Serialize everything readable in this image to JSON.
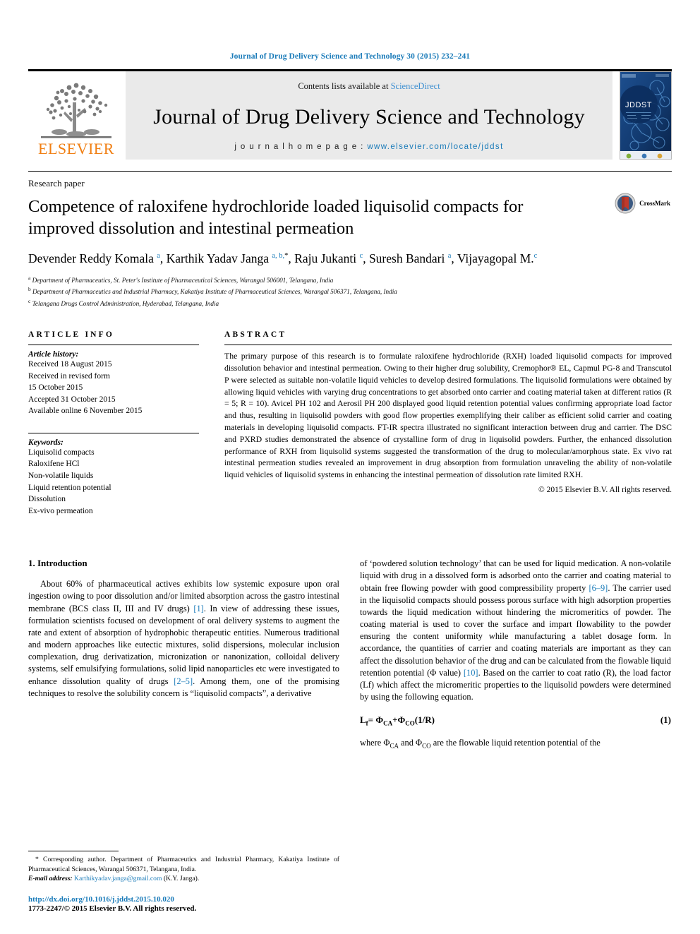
{
  "running_head": "Journal of Drug Delivery Science and Technology 30 (2015) 232–241",
  "masthead": {
    "publisher_name": "ELSEVIER",
    "contents_prefix": "Contents lists available at ",
    "contents_link": "ScienceDirect",
    "journal_name": "Journal of Drug Delivery Science and Technology",
    "homepage_prefix": "j o u r n a l   h o m e p a g e :   ",
    "homepage_url": "www.elsevier.com/locate/jddst",
    "cover_title": "JDDST"
  },
  "article": {
    "type": "Research paper",
    "title": "Competence of raloxifene hydrochloride loaded liquisolid compacts for improved dissolution and intestinal permeation",
    "crossmark_label": "CrossMark",
    "authors_html": "Devender Reddy Komala <sup>a</sup>, Karthik Yadav Janga <sup>a, b,</sup><sup class=\"star\">*</sup>, Raju Jukanti <sup>c</sup>, Suresh Bandari <sup>a</sup>, Vijayagopal M.<sup>c</sup>",
    "affiliations": [
      {
        "mark": "a",
        "text": "Department of Pharmaceutics, St. Peter's Institute of Pharmaceutical Sciences, Warangal 506001, Telangana, India"
      },
      {
        "mark": "b",
        "text": "Department of Pharmaceutics and Industrial Pharmacy, Kakatiya Institute of Pharmaceutical Sciences, Warangal 506371, Telangana, India"
      },
      {
        "mark": "c",
        "text": "Telangana Drugs Control Administration, Hyderabad, Telangana, India"
      }
    ]
  },
  "article_info": {
    "heading": "ARTICLE INFO",
    "history_label": "Article history:",
    "history": [
      "Received 18 August 2015",
      "Received in revised form",
      "15 October 2015",
      "Accepted 31 October 2015",
      "Available online 6 November 2015"
    ],
    "keywords_label": "Keywords:",
    "keywords": [
      "Liquisolid compacts",
      "Raloxifene HCl",
      "Non-volatile liquids",
      "Liquid retention potential",
      "Dissolution",
      "Ex-vivo permeation"
    ]
  },
  "abstract": {
    "heading": "ABSTRACT",
    "text": "The primary purpose of this research is to formulate raloxifene hydrochloride (RXH) loaded liquisolid compacts for improved dissolution behavior and intestinal permeation. Owing to their higher drug solubility, Cremophor® EL, Capmul PG-8 and Transcutol P were selected as suitable non-volatile liquid vehicles to develop desired formulations. The liquisolid formulations were obtained by allowing liquid vehicles with varying drug concentrations to get absorbed onto carrier and coating material taken at different ratios (R = 5; R = 10). Avicel PH 102 and Aerosil PH 200 displayed good liquid retention potential values confirming appropriate load factor and thus, resulting in liquisolid powders with good flow properties exemplifying their caliber as efficient solid carrier and coating materials in developing liquisolid compacts. FT-IR spectra illustrated no significant interaction between drug and carrier. The DSC and PXRD studies demonstrated the absence of crystalline form of drug in liquisolid powders. Further, the enhanced dissolution performance of RXH from liquisolid systems suggested the transformation of the drug to molecular/amorphous state. Ex vivo rat intestinal permeation studies revealed an improvement in drug absorption from formulation unraveling the ability of non-volatile liquid vehicles of liquisolid systems in enhancing the intestinal permeation of dissolution rate limited RXH.",
    "copyright": "© 2015 Elsevier B.V. All rights reserved."
  },
  "introduction": {
    "heading": "1. Introduction",
    "left_paragraph_html": "About 60% of pharmaceutical actives exhibits low systemic exposure upon oral ingestion owing to poor dissolution and/or limited absorption across the gastro intestinal membrane (BCS class II, III and IV drugs) <span class=\"cit\">[1]</span>. In view of addressing these issues, formulation scientists focused on development of oral delivery systems to augment the rate and extent of absorption of hydrophobic therapeutic entities. Numerous traditional and modern approaches like eutectic mixtures, solid dispersions, molecular inclusion complexation, drug derivatization, micronization or nanonization, colloidal delivery systems, self emulsifying formulations, solid lipid nanoparticles etc were investigated to enhance dissolution quality of drugs <span class=\"cit\">[2–5]</span>. Among them, one of the promising techniques to resolve the solubility concern is “liquisolid compacts”, a derivative",
    "right_paragraph_html": "of ‘powdered solution technology’ that can be used for liquid medication. A non-volatile liquid with drug in a dissolved form is adsorbed onto the carrier and coating material to obtain free flowing powder with good compressibility property <span class=\"cit\">[6–9]</span>. The carrier used in the liquisolid compacts should possess porous surface with high adsorption properties towards the liquid medication without hindering the micromeritics of powder. The coating material is used to cover the surface and impart flowability to the powder ensuring the content uniformity while manufacturing a tablet dosage form. In accordance, the quantities of carrier and coating materials are important as they can affect the dissolution behavior of the drug and can be calculated from the flowable liquid retention potential (Φ value) <span class=\"cit\">[10]</span>. Based on the carrier to coat ratio (R), the load factor (Lf) which affect the micromeritic properties to the liquisolid powders were determined by using the following equation.",
    "equation_html": "L<sub>f</sub>= Φ<sub>CA</sub>+Φ<sub>CO</sub>(1/R)",
    "equation_number": "(1)",
    "after_equation_html": "where Φ<sub>CA</sub> and Φ<sub>CO</sub> are the flowable liquid retention potential of the"
  },
  "footnote": {
    "corresponding_html": "<span class=\"lead\">*</span> Corresponding author. Department of Pharmaceutics and Industrial Pharmacy, Kakatiya Institute of Pharmaceutical Sciences, Warangal 506371, Telangana, India.",
    "email_label": "E-mail address:",
    "email": "Karthikyadav.janga@gmail.com",
    "email_owner": "(K.Y. Janga).",
    "doi": "http://dx.doi.org/10.1016/j.jddst.2015.10.020",
    "issn": "1773-2247/© 2015 Elsevier B.V. All rights reserved."
  }
}
